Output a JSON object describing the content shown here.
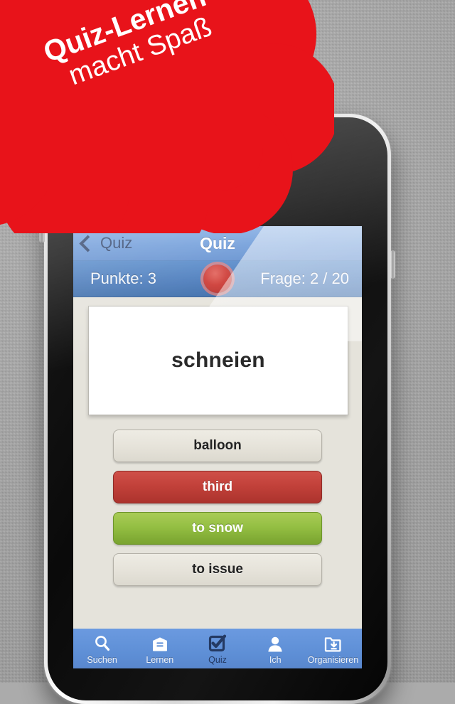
{
  "promo": {
    "line1": "Quiz-Lernen",
    "line2": "macht Spaß",
    "color": "#e8131a"
  },
  "app": {
    "navbar": {
      "back_label": "Quiz",
      "back_icon": "chevron-left-icon",
      "title": "Quiz",
      "color": "#6293d6"
    },
    "scorebar": {
      "score_label": "Punkte: 3",
      "question_label": "Frage: 2 / 20",
      "indicator_icon": "red-circle-icon",
      "indicator_color": "#cb322c",
      "color": "#3f72b6"
    },
    "card": {
      "word": "schneien"
    },
    "answers": [
      {
        "label": "balloon",
        "state": "neutral"
      },
      {
        "label": "third",
        "state": "wrong",
        "color": "#c2413a"
      },
      {
        "label": "to snow",
        "state": "correct",
        "color": "#94bf43"
      },
      {
        "label": "to issue",
        "state": "neutral"
      }
    ],
    "tabbar": [
      {
        "label": "Suchen",
        "icon": "search-icon",
        "active": false
      },
      {
        "label": "Lernen",
        "icon": "box-icon",
        "active": false
      },
      {
        "label": "Quiz",
        "icon": "checkbox-icon",
        "active": true
      },
      {
        "label": "Ich",
        "icon": "person-icon",
        "active": false
      },
      {
        "label": "Organisieren",
        "icon": "folder-down-icon",
        "active": false
      }
    ]
  }
}
